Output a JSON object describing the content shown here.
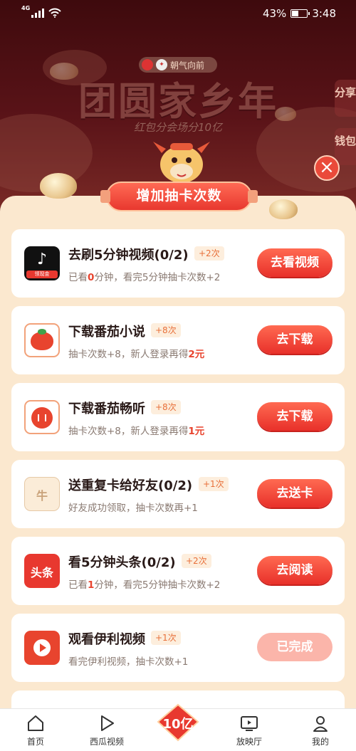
{
  "status_bar": {
    "network": "4G",
    "battery": "43%",
    "time": "3:48"
  },
  "background": {
    "brand_tag": "朝气向前",
    "title": "团圆家乡年",
    "subtitle": "红包分会场分10亿",
    "side_tabs": [
      "分享",
      "钱包"
    ]
  },
  "dialog": {
    "title": "增加抽卡次数",
    "close_symbol": "×",
    "tasks": [
      {
        "title": "去刷5分钟视频(0/2)",
        "badge": "+2次",
        "desc_pre": "已看",
        "desc_hl": "0",
        "desc_post": "分钟，看完5分钟抽卡次数+2",
        "button": "去看视频",
        "icon": "douyin-icon",
        "icon_tag": "领现金",
        "done": false
      },
      {
        "title": "下载番茄小说",
        "badge": "+8次",
        "desc_pre": "抽卡次数+8，新人登录再得",
        "desc_hl": "2元",
        "desc_post": "",
        "button": "去下载",
        "icon": "tomato-novel-icon",
        "done": false
      },
      {
        "title": "下载番茄畅听",
        "badge": "+8次",
        "desc_pre": "抽卡次数+8，新人登录再得",
        "desc_hl": "1元",
        "desc_post": "",
        "button": "去下载",
        "icon": "tomato-listen-icon",
        "done": false
      },
      {
        "title": "送重复卡给好友(0/2)",
        "badge": "+1次",
        "desc_pre": "好友成功领取，抽卡次数再+1",
        "desc_hl": "",
        "desc_post": "",
        "button": "去送卡",
        "icon": "card-gift-icon",
        "icon_tag": "牛",
        "done": false
      },
      {
        "title": "看5分钟头条(0/2)",
        "badge": "+2次",
        "desc_pre": "已看",
        "desc_hl": "1",
        "desc_post": "分钟，看完5分钟抽卡次数+2",
        "button": "去阅读",
        "icon": "toutiao-icon",
        "icon_tag": "头条",
        "done": false
      },
      {
        "title": "观看伊利视频",
        "badge": "+1次",
        "desc_pre": "看完伊利视频，抽卡次数+1",
        "desc_hl": "",
        "desc_post": "",
        "button": "已完成",
        "icon": "video-play-icon",
        "done": true
      }
    ]
  },
  "tabbar": {
    "items": [
      {
        "label": "首页",
        "icon": "home-icon"
      },
      {
        "label": "西瓜视频",
        "icon": "play-icon"
      },
      {
        "label": "放映厅",
        "icon": "tv-icon"
      },
      {
        "label": "我的",
        "icon": "user-icon"
      }
    ],
    "center": {
      "label": "10亿",
      "icon": "red-envelope-icon"
    }
  },
  "colors": {
    "accent": "#e8382f",
    "sheet": "#fbe8cf",
    "badge_text": "#e8703a"
  }
}
